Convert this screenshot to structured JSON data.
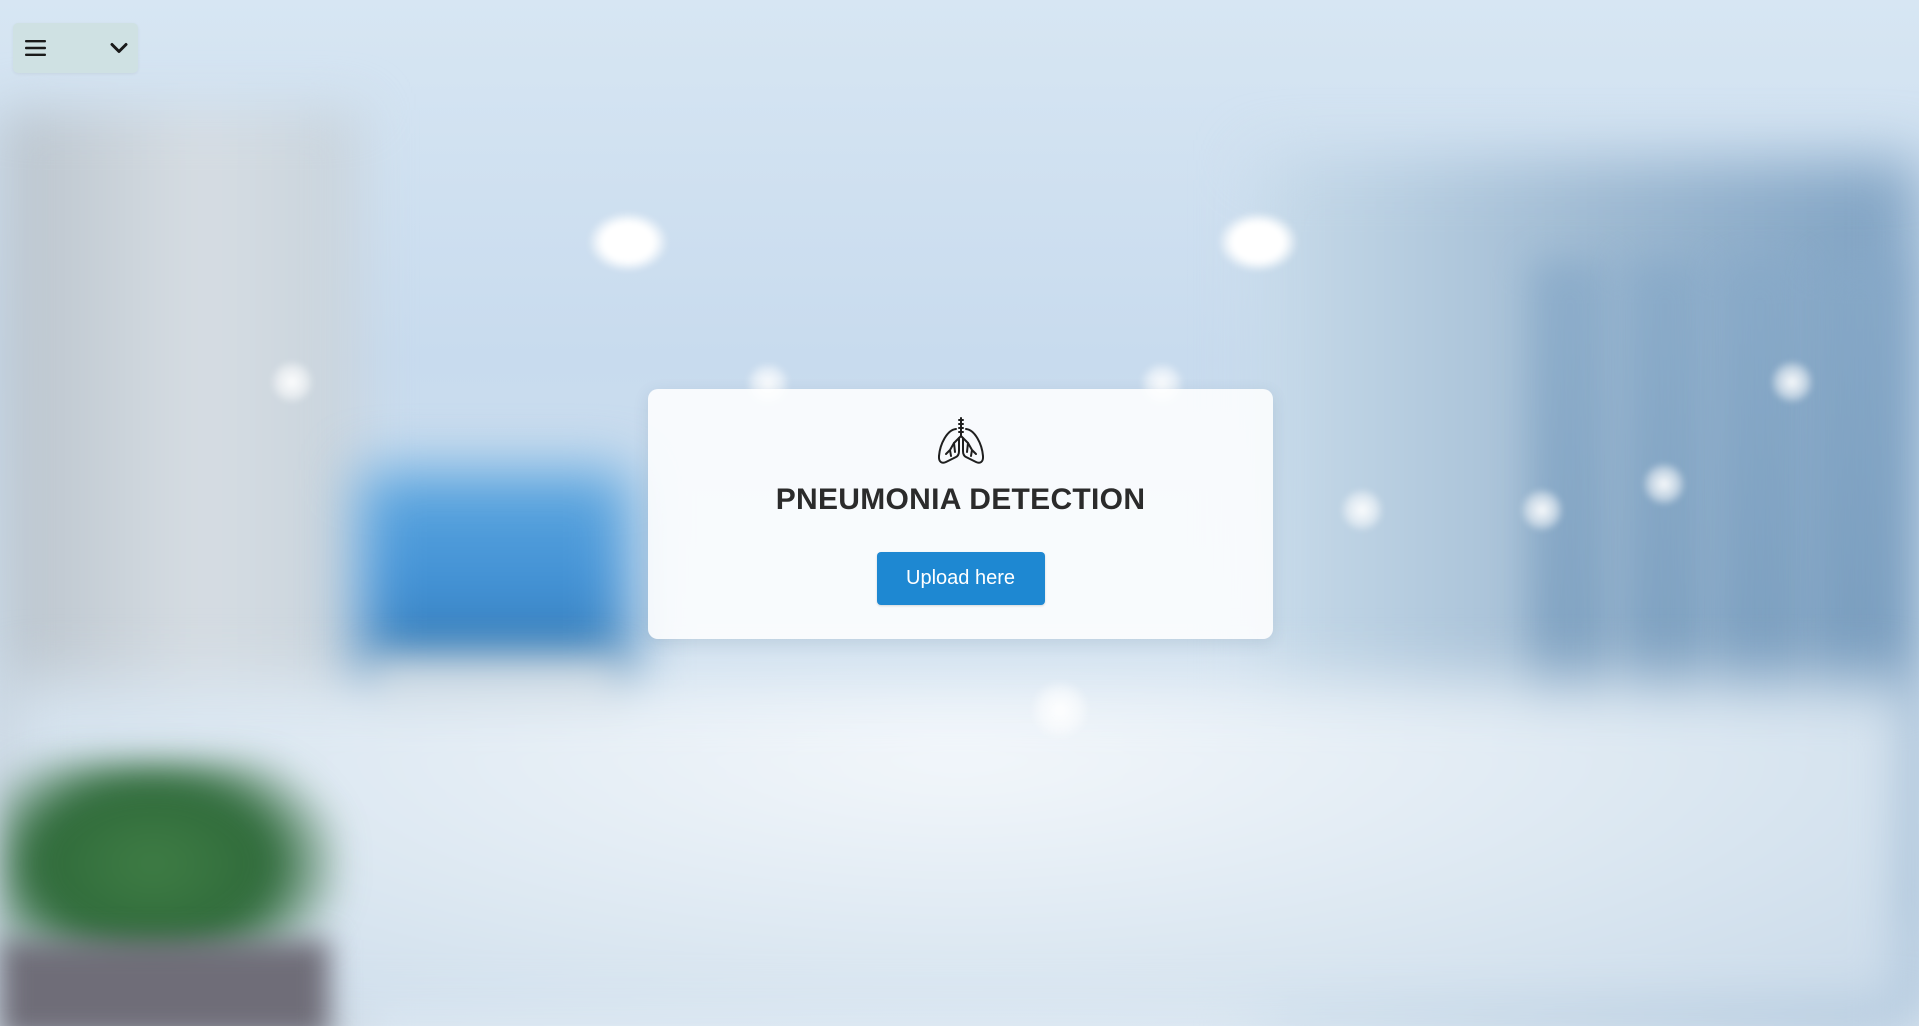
{
  "menu": {
    "icon": "hamburger-menu-icon",
    "dropdown_icon": "chevron-down-icon",
    "background_color": "#cfe1e3"
  },
  "card": {
    "icon": "lungs-icon",
    "title": "PNEUMONIA DETECTION",
    "upload_label": "Upload here",
    "button_color": "#1e88d2"
  },
  "background": {
    "description_icon": "blurred-hospital-corridor-image"
  }
}
